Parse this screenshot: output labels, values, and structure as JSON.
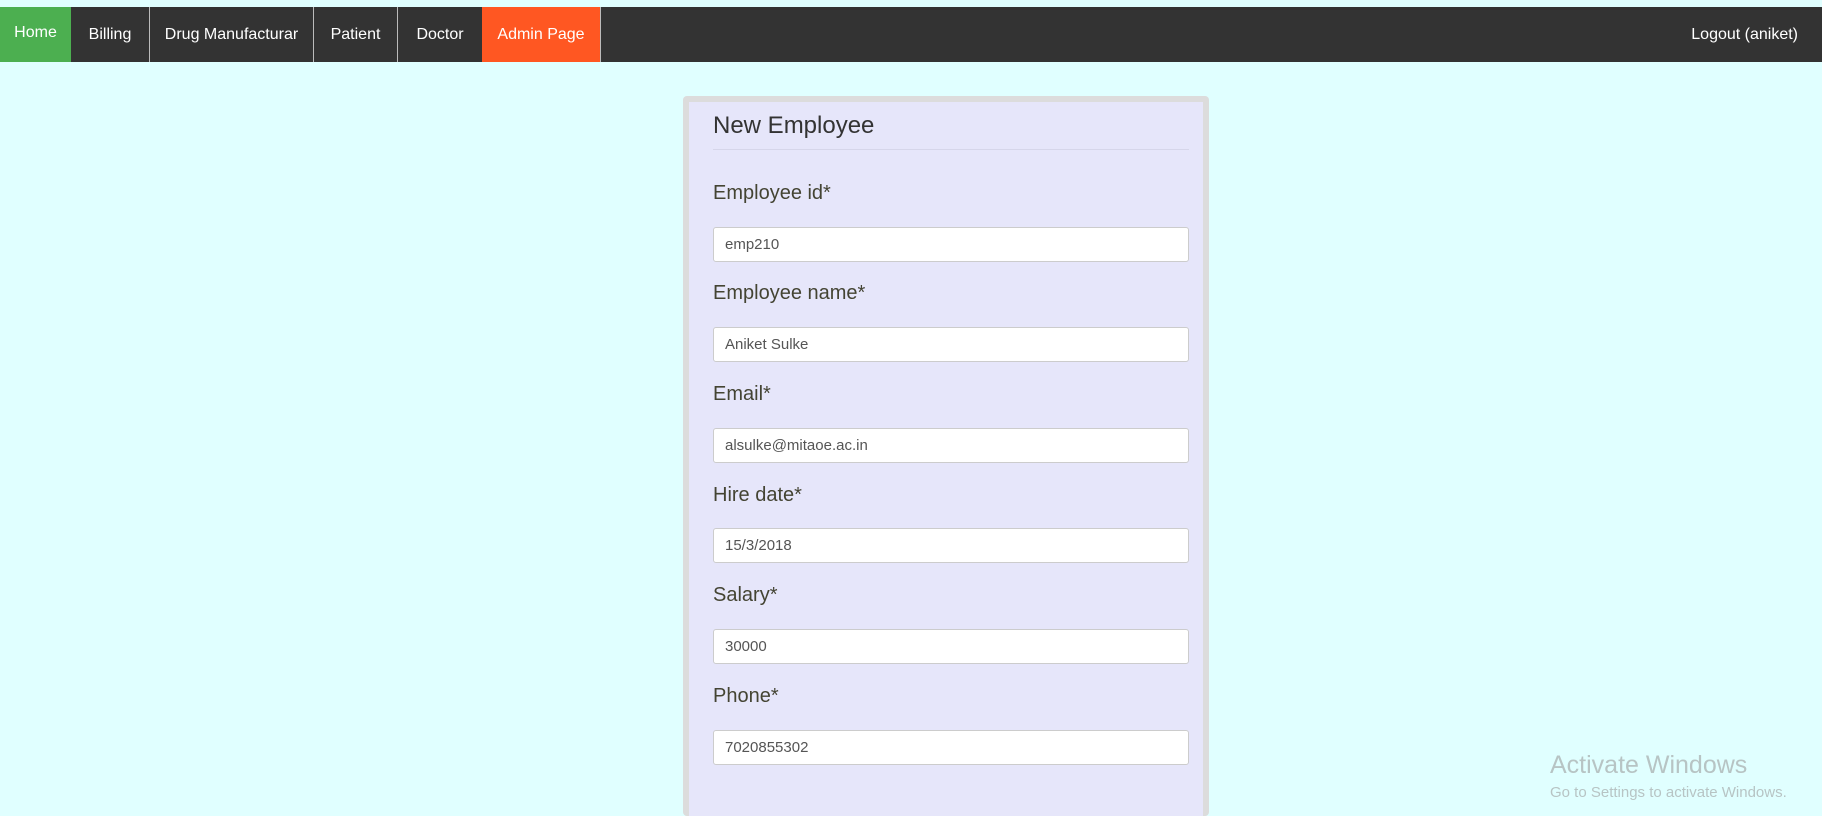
{
  "nav": {
    "home": "Home",
    "billing": "Billing",
    "drug_manufacturer": "Drug Manufacturar",
    "patient": "Patient",
    "doctor": "Doctor",
    "admin": "Admin Page",
    "logout": "Logout (aniket)",
    "colors": {
      "bar": "#333333",
      "home_active": "#4caf50",
      "admin_highlight": "#ff5722"
    }
  },
  "form": {
    "title": "New Employee",
    "fields": {
      "employee_id": {
        "label": "Employee id*",
        "value": "emp210"
      },
      "employee_name": {
        "label": "Employee name*",
        "value": "Aniket Sulke"
      },
      "email": {
        "label": "Email*",
        "value": "alsulke@mitaoe.ac.in"
      },
      "hire_date": {
        "label": "Hire date*",
        "value": "15/3/2018"
      },
      "salary": {
        "label": "Salary*",
        "value": "30000"
      },
      "phone": {
        "label": "Phone*",
        "value": "7020855302"
      }
    }
  },
  "watermark": {
    "title": "Activate Windows",
    "subtitle": "Go to Settings to activate Windows."
  }
}
